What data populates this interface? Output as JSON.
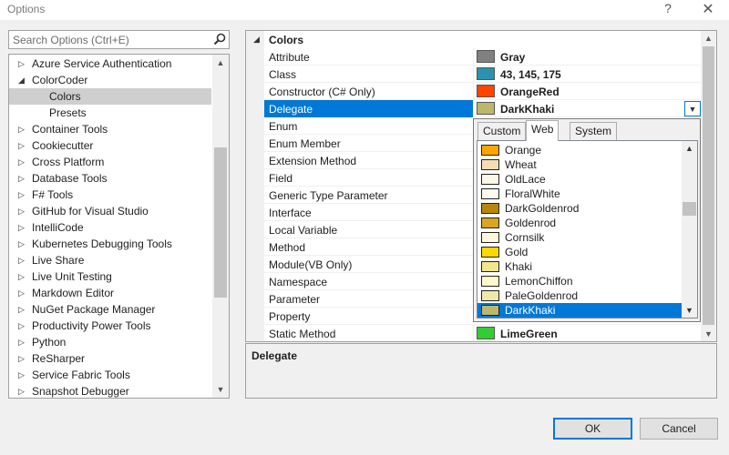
{
  "window": {
    "title": "Options",
    "help": "?",
    "close": "✕"
  },
  "search": {
    "placeholder": "Search Options (Ctrl+E)"
  },
  "tree": {
    "items": [
      {
        "label": "Azure Service Authentication",
        "arrow": "▷",
        "indent": 0,
        "selected": false
      },
      {
        "label": "ColorCoder",
        "arrow": "◢",
        "indent": 0,
        "selected": false
      },
      {
        "label": "Colors",
        "arrow": "",
        "indent": 1,
        "selected": true
      },
      {
        "label": "Presets",
        "arrow": "",
        "indent": 1,
        "selected": false
      },
      {
        "label": "Container Tools",
        "arrow": "▷",
        "indent": 0,
        "selected": false
      },
      {
        "label": "Cookiecutter",
        "arrow": "▷",
        "indent": 0,
        "selected": false
      },
      {
        "label": "Cross Platform",
        "arrow": "▷",
        "indent": 0,
        "selected": false
      },
      {
        "label": "Database Tools",
        "arrow": "▷",
        "indent": 0,
        "selected": false
      },
      {
        "label": "F# Tools",
        "arrow": "▷",
        "indent": 0,
        "selected": false
      },
      {
        "label": "GitHub for Visual Studio",
        "arrow": "▷",
        "indent": 0,
        "selected": false
      },
      {
        "label": "IntelliCode",
        "arrow": "▷",
        "indent": 0,
        "selected": false
      },
      {
        "label": "Kubernetes Debugging Tools",
        "arrow": "▷",
        "indent": 0,
        "selected": false
      },
      {
        "label": "Live Share",
        "arrow": "▷",
        "indent": 0,
        "selected": false
      },
      {
        "label": "Live Unit Testing",
        "arrow": "▷",
        "indent": 0,
        "selected": false
      },
      {
        "label": "Markdown Editor",
        "arrow": "▷",
        "indent": 0,
        "selected": false
      },
      {
        "label": "NuGet Package Manager",
        "arrow": "▷",
        "indent": 0,
        "selected": false
      },
      {
        "label": "Productivity Power Tools",
        "arrow": "▷",
        "indent": 0,
        "selected": false
      },
      {
        "label": "Python",
        "arrow": "▷",
        "indent": 0,
        "selected": false
      },
      {
        "label": "ReSharper",
        "arrow": "▷",
        "indent": 0,
        "selected": false
      },
      {
        "label": "Service Fabric Tools",
        "arrow": "▷",
        "indent": 0,
        "selected": false
      },
      {
        "label": "Snapshot Debugger",
        "arrow": "▷",
        "indent": 0,
        "selected": false
      }
    ]
  },
  "grid": {
    "category": "Colors",
    "rows": [
      {
        "name": "Attribute",
        "value": "Gray",
        "color": "#808080"
      },
      {
        "name": "Class",
        "value": "43, 145, 175",
        "color": "#2b91af"
      },
      {
        "name": "Constructor (C# Only)",
        "value": "OrangeRed",
        "color": "#ff4500"
      },
      {
        "name": "Delegate",
        "value": "DarkKhaki",
        "color": "#bdb76b",
        "selected": true
      },
      {
        "name": "Enum",
        "value": "",
        "color": ""
      },
      {
        "name": "Enum Member",
        "value": "",
        "color": ""
      },
      {
        "name": "Extension Method",
        "value": "",
        "color": ""
      },
      {
        "name": "Field",
        "value": "",
        "color": ""
      },
      {
        "name": "Generic Type Parameter",
        "value": "",
        "color": ""
      },
      {
        "name": "Interface",
        "value": "",
        "color": ""
      },
      {
        "name": "Local Variable",
        "value": "",
        "color": ""
      },
      {
        "name": "Method",
        "value": "",
        "color": ""
      },
      {
        "name": "Module(VB Only)",
        "value": "",
        "color": ""
      },
      {
        "name": "Namespace",
        "value": "",
        "color": ""
      },
      {
        "name": "Parameter",
        "value": "",
        "color": ""
      },
      {
        "name": "Property",
        "value": "",
        "color": ""
      },
      {
        "name": "Static Method",
        "value": "LimeGreen",
        "color": "#32cd32"
      }
    ]
  },
  "popup": {
    "tabs": [
      "Custom",
      "Web",
      "System"
    ],
    "active_tab": "Web",
    "colors": [
      {
        "name": "Orange",
        "color": "#ffa500"
      },
      {
        "name": "Wheat",
        "color": "#f5deb3"
      },
      {
        "name": "OldLace",
        "color": "#fdf5e6"
      },
      {
        "name": "FloralWhite",
        "color": "#fffaf0"
      },
      {
        "name": "DarkGoldenrod",
        "color": "#b8860b"
      },
      {
        "name": "Goldenrod",
        "color": "#daa520"
      },
      {
        "name": "Cornsilk",
        "color": "#fff8dc"
      },
      {
        "name": "Gold",
        "color": "#ffd700"
      },
      {
        "name": "Khaki",
        "color": "#f0e68c"
      },
      {
        "name": "LemonChiffon",
        "color": "#fffacd"
      },
      {
        "name": "PaleGoldenrod",
        "color": "#eee8aa"
      },
      {
        "name": "DarkKhaki",
        "color": "#bdb76b",
        "selected": true
      }
    ]
  },
  "description": {
    "title": "Delegate"
  },
  "buttons": {
    "ok": "OK",
    "cancel": "Cancel"
  }
}
